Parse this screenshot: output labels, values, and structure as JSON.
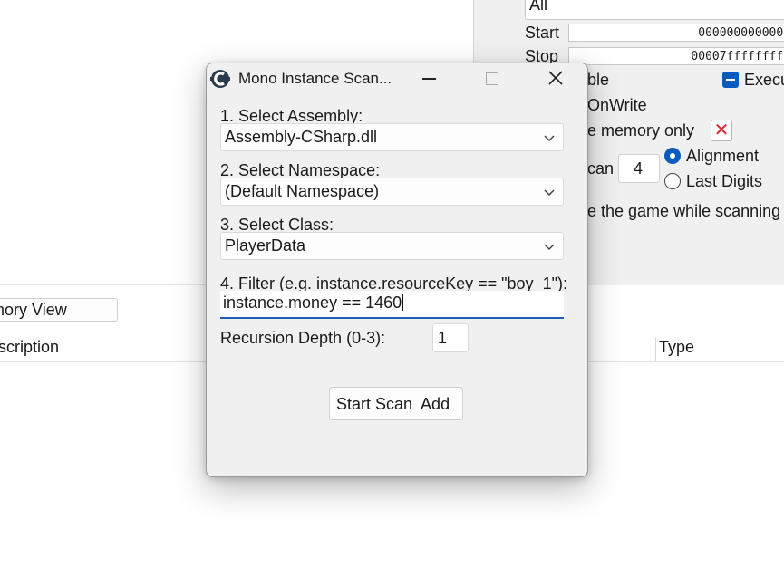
{
  "background": {
    "scan_type_value": "All",
    "start_label": "Start",
    "start_value": "0000000000000",
    "stop_label": "Stop",
    "stop_value": "00007fffffffff",
    "writable_label": "ble",
    "executable_label": "Execu",
    "copy_on_write_label": "OnWrite",
    "memory_only_label": "e memory only",
    "fast_scan_label": "can",
    "fast_scan_value": "4",
    "alignment_label": "Alignment",
    "last_digits_label": "Last Digits",
    "pause_label": "e the game while scanning",
    "memory_view_label": "nory View",
    "col_description": "scription",
    "col_type": "Type"
  },
  "dialog": {
    "title": "Mono Instance Scan...",
    "assembly_label": "1. Select Assembly:",
    "assembly_value": "Assembly-CSharp.dll",
    "namespace_label": "2. Select Namespace:",
    "namespace_value": "(Default Namespace)",
    "class_label": "3. Select Class:",
    "class_value": "PlayerData",
    "filter_label": "4. Filter (e.g. instance.resourceKey == \"boy_1\"):",
    "filter_value": "instance.money == 1460",
    "depth_label": "Recursion Depth (0-3):",
    "depth_value": "1",
    "start_button_label": "Start Scan  Add"
  },
  "colors": {
    "accent": "#0a5bbf",
    "close_x_red": "#e0242d",
    "dialog_bg": "#f0f0f0"
  },
  "icons": [
    "cheat-engine-icon",
    "minimize-icon",
    "maximize-icon",
    "close-icon",
    "chevron-down-icon",
    "x-mark-icon"
  ]
}
